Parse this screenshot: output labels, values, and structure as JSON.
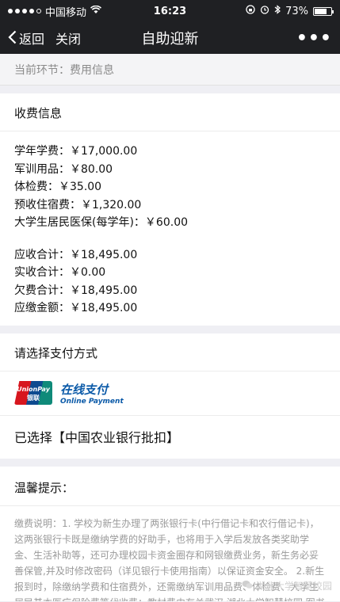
{
  "status_bar": {
    "carrier": "中国移动",
    "time": "16:23",
    "battery": "73%",
    "battery_level": 0.73
  },
  "nav": {
    "back_label": "返回",
    "close_label": "关闭",
    "title": "自助迎新",
    "more_label": "•••"
  },
  "stage": {
    "text": "当前环节：费用信息"
  },
  "fee_section": {
    "header": "收费信息",
    "items": [
      "学年学费：￥17,000.00",
      "军训用品：￥80.00",
      "体检费：￥35.00",
      "预收住宿费：￥1,320.00",
      "大学生居民医保(每学年)：￥60.00"
    ],
    "totals": [
      "应收合计：￥18,495.00",
      "实收合计：￥0.00",
      "欠费合计：￥18,495.00",
      "应缴金额：￥18,495.00"
    ]
  },
  "payment": {
    "header": "请选择支付方式",
    "logo_text_en": "UnionPay",
    "logo_text_cn": "银联",
    "online_cn": "在线支付",
    "online_en": "Online Payment",
    "selected": "已选择【中国农业银行批扣】"
  },
  "tips": {
    "header": "温馨提示：",
    "body": "缴费说明：1. 学校为新生办理了两张银行卡(中行借记卡和农行借记卡)，这两张银行卡既是缴纳学费的好助手，也将用于入学后发放各类奖助学金、生活补助等，还可办理校园卡资金圈存和网银缴费业务，新生务必妥善保管,并及时修改密码（详见银行卡使用指南）以保证资金安全。 2.新生报到时，除缴纳学费和住宿费外，还需缴纳军训用品费、体检费、大学生居民基本医疗保险费等代收费；教材费由有关武汉 湖北大学智慧校园 图书有限书刊公"
  },
  "watermark": {
    "text": "湖北大学智慧校园"
  },
  "colors": {
    "bar_bg": "#1f2023",
    "unionpay_red": "#d7161e",
    "unionpay_blue": "#0d4a8f",
    "unionpay_green": "#0f8a79"
  }
}
